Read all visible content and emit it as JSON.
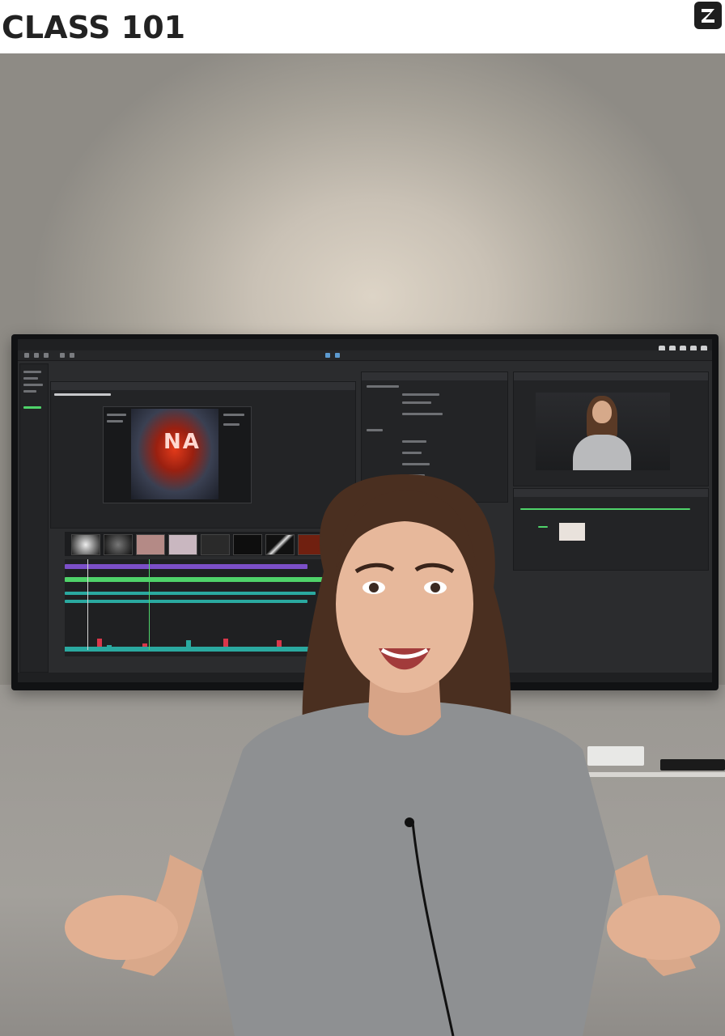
{
  "header": {
    "brand": "CLASS 101",
    "logo_icon": "class101-logo-icon"
  },
  "scene": {
    "description_icon": "presenter-photo",
    "screen_app": {
      "viewer_overlay_text": "NA"
    }
  },
  "colors": {
    "header_bg": "#ffffff",
    "brand_text": "#222222",
    "monitor_ui_bg": "#2b2c2e",
    "timeline_green": "#4fd36a",
    "timeline_purple": "#7b4fc8",
    "timeline_teal": "#2aa9a0"
  }
}
